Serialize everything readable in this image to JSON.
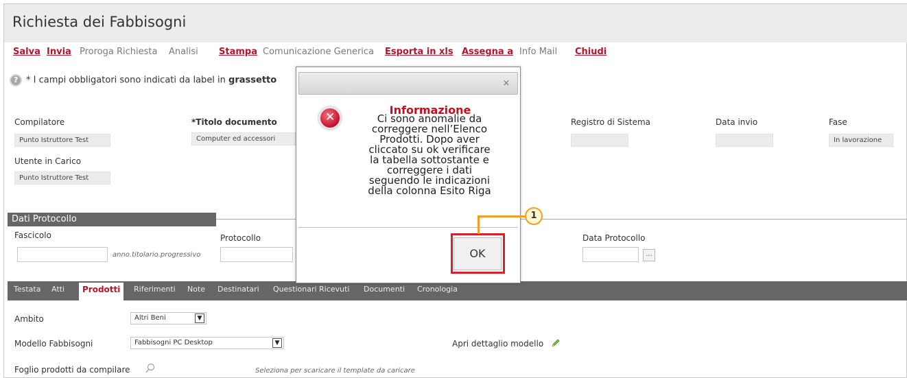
{
  "window": {
    "title": "Richiesta dei Fabbisogni"
  },
  "toolbar": [
    {
      "label": "Salva",
      "active": true
    },
    {
      "label": "Invia",
      "active": true
    },
    {
      "label": "Proroga Richiesta",
      "active": false
    },
    {
      "label": "Analisi",
      "active": false
    },
    {
      "label": "Stampa",
      "active": true
    },
    {
      "label": "Comunicazione Generica",
      "active": false
    },
    {
      "label": "Esporta in xls",
      "active": true
    },
    {
      "label": "Assegna a",
      "active": true
    },
    {
      "label": "Info Mail",
      "active": false
    },
    {
      "label": "Chiudi",
      "active": true
    }
  ],
  "notice": {
    "prefix": "* I campi obbligatori sono indicati da label in ",
    "emphasis": "grassetto"
  },
  "header_fields": {
    "compilatore": {
      "label": "Compilatore",
      "value": "Punto Istruttore Test"
    },
    "titolo": {
      "required_mark": "*",
      "label": "Titolo documento",
      "value": "Computer ed accessori"
    },
    "utente": {
      "label": "Utente in Carico",
      "value": "Punto Istruttore Test"
    },
    "registro": {
      "label": "Registro di Sistema",
      "value": ""
    },
    "data_invio": {
      "label": "Data invio",
      "value": ""
    },
    "fase": {
      "label": "Fase",
      "value": "In lavorazione"
    }
  },
  "protocollo": {
    "section_title": "Dati Protocollo",
    "fascicolo_label": "Fascicolo",
    "fascicolo_hint": "anno.titolario.progressivo",
    "protocollo_label": "Protocollo",
    "data_label": "Data Protocollo",
    "picker_label": "..."
  },
  "tabs": [
    {
      "label": "Testata",
      "selected": false
    },
    {
      "label": "Atti",
      "selected": false
    },
    {
      "label": "Prodotti",
      "selected": true
    },
    {
      "label": "Riferimenti",
      "selected": false
    },
    {
      "label": "Note",
      "selected": false
    },
    {
      "label": "Destinatari",
      "selected": false
    },
    {
      "label": "Questionari Ricevuti",
      "selected": false
    },
    {
      "label": "Documenti",
      "selected": false
    },
    {
      "label": "Cronologia",
      "selected": false
    }
  ],
  "prodotti": {
    "ambito_label": "Ambito",
    "ambito_value": "Altri Beni",
    "modello_label": "Modello Fabbisogni",
    "modello_value": "Fabbisogni PC Desktop",
    "apri_label": "Apri dettaglio modello",
    "foglio_label": "Foglio prodotti da compilare",
    "foglio_hint": "Seleziona per scaricare il template da caricare"
  },
  "dialog": {
    "close_glyph": "×",
    "title": "Informazione",
    "message_lines": [
      "Ci sono anomalie da",
      "correggere nell’Elenco",
      "Prodotti. Dopo aver",
      "cliccato su ok verificare",
      "la tabella sottostante e",
      "correggere i dati",
      "seguendo le indicazioni",
      "della colonna Esito Riga"
    ],
    "ok_label": "OK"
  },
  "callout": {
    "number": "1"
  },
  "colors": {
    "accent_red": "#b3162b",
    "callout_orange": "#f39c26",
    "tab_bar": "#666666"
  }
}
